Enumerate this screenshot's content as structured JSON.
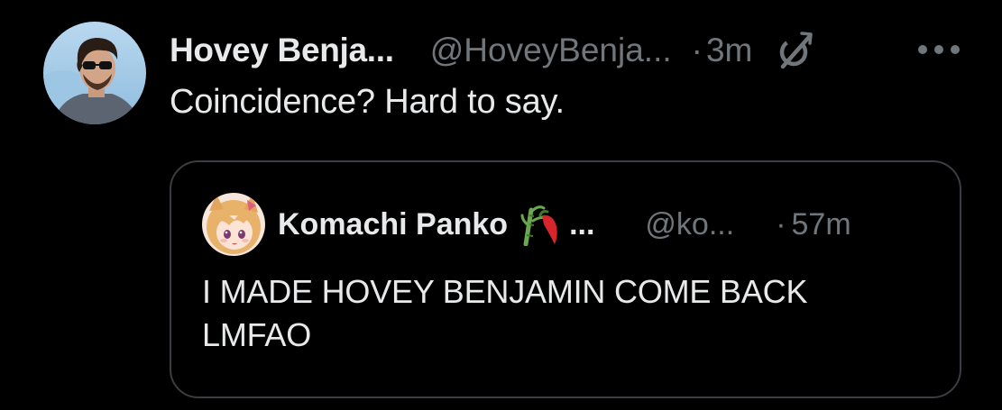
{
  "tweet": {
    "author_name": "Hovey Benja...",
    "author_handle": "@HoveyBenja...",
    "separator": "·",
    "time": "3m",
    "text": "Coincidence? Hard to say.",
    "icons": {
      "avatar": "avatar-icon",
      "grok": "grok-icon",
      "more": "more-icon"
    }
  },
  "quote": {
    "author_name": "Komachi Panko",
    "name_ellipsis": "...",
    "author_handle": "@ko...",
    "separator": "·",
    "time": "57m",
    "text": "I MADE HOVEY BENJAMIN COME BACK LMFAO",
    "icons": {
      "avatar": "avatar-icon",
      "emoji": "bamboo-chili-emoji-icon"
    }
  },
  "colors": {
    "background": "#000000",
    "primary_text": "#e7e9ea",
    "secondary_text": "#71767b",
    "border": "#3a3d41"
  }
}
